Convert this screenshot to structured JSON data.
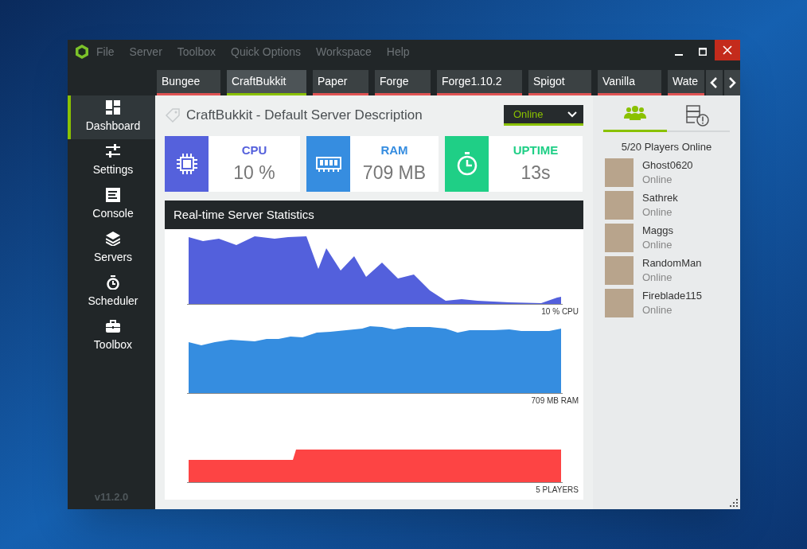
{
  "menu": [
    "File",
    "Server",
    "Toolbox",
    "Quick Options",
    "Workspace",
    "Help"
  ],
  "server_tabs": [
    {
      "label": "Bungee",
      "selected": false
    },
    {
      "label": "CraftBukkit",
      "selected": true
    },
    {
      "label": "Paper",
      "selected": false
    },
    {
      "label": "Forge",
      "selected": false
    },
    {
      "label": "Forge1.10.2",
      "selected": false
    },
    {
      "label": "Spigot",
      "selected": false
    },
    {
      "label": "Vanilla",
      "selected": false
    },
    {
      "label": "Wate",
      "selected": false
    }
  ],
  "sidebar": {
    "items": [
      {
        "label": "Dashboard",
        "selected": true
      },
      {
        "label": "Settings",
        "selected": false
      },
      {
        "label": "Console",
        "selected": false
      },
      {
        "label": "Servers",
        "selected": false
      },
      {
        "label": "Scheduler",
        "selected": false
      },
      {
        "label": "Toolbox",
        "selected": false
      }
    ],
    "version": "v11.2.0"
  },
  "server": {
    "title": "CraftBukkit - Default Server Description",
    "status": "Online"
  },
  "stats": [
    {
      "kind": "cpu",
      "label": "CPU",
      "value": "10 %",
      "color": "#5561dc"
    },
    {
      "kind": "ram",
      "label": "RAM",
      "value": "709 MB",
      "color": "#368de0"
    },
    {
      "kind": "uptime",
      "label": "UPTIME",
      "value": "13s",
      "color": "#1fcf86"
    }
  ],
  "statistics": {
    "title": "Real-time Server Statistics",
    "graphs": [
      {
        "kind": "cpu",
        "label": "10 % CPU"
      },
      {
        "kind": "ram",
        "label": "709 MB RAM"
      },
      {
        "kind": "players",
        "label": "5 PLAYERS"
      }
    ]
  },
  "players_panel": {
    "tabs": [
      {
        "kind": "players",
        "selected": true
      },
      {
        "kind": "alerts",
        "selected": false
      }
    ],
    "summary": "5/20 Players Online",
    "players": [
      {
        "name": "Ghost0620",
        "status": "Online"
      },
      {
        "name": "Sathrek",
        "status": "Online"
      },
      {
        "name": "Maggs",
        "status": "Online"
      },
      {
        "name": "RandomMan",
        "status": "Online"
      },
      {
        "name": "Fireblade115",
        "status": "Online"
      }
    ]
  }
}
